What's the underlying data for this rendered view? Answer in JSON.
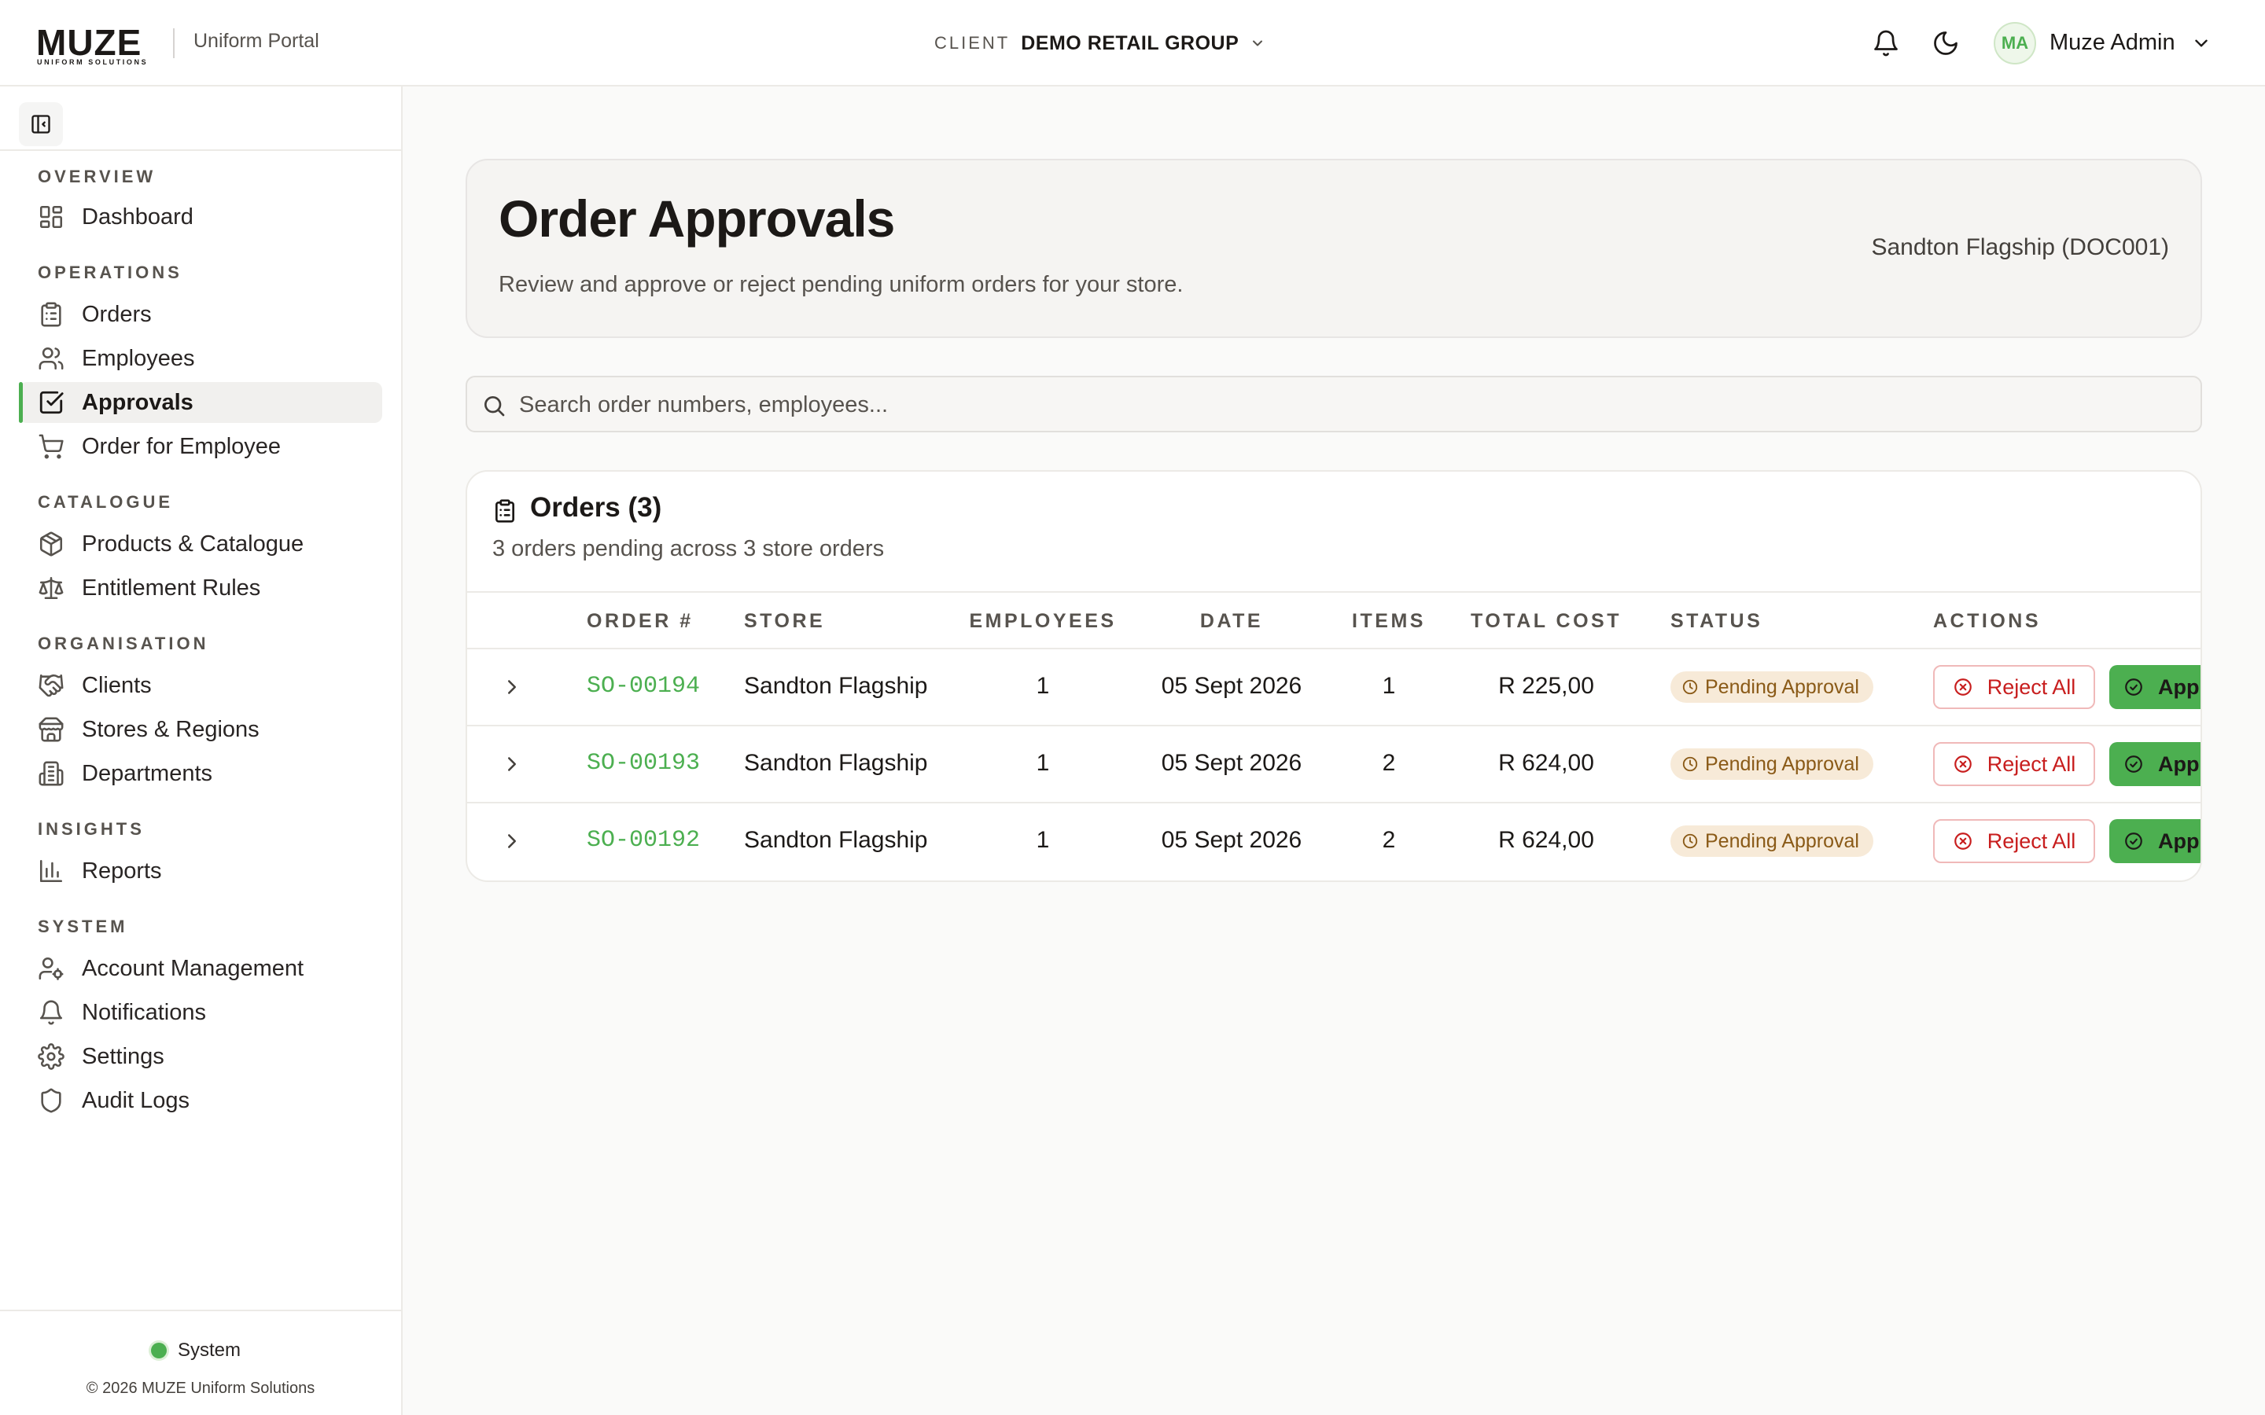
{
  "header": {
    "logo_text": "MUZE",
    "logo_subtext": "UNIFORM SOLUTIONS",
    "portal_name": "Uniform Portal",
    "client_label": "CLIENT",
    "client_name": "DEMO RETAIL GROUP",
    "user_initials": "MA",
    "user_name": "Muze Admin",
    "icons": [
      "bell-icon",
      "moon-icon",
      "chevron-down-icon"
    ]
  },
  "sidebar": {
    "sections": [
      {
        "label": "OVERVIEW",
        "items": [
          {
            "label": "Dashboard",
            "icon": "dashboard-icon"
          }
        ]
      },
      {
        "label": "OPERATIONS",
        "items": [
          {
            "label": "Orders",
            "icon": "clipboard-icon"
          },
          {
            "label": "Employees",
            "icon": "users-icon"
          },
          {
            "label": "Approvals",
            "icon": "check-square-icon",
            "active": true
          },
          {
            "label": "Order for Employee",
            "icon": "cart-icon"
          }
        ]
      },
      {
        "label": "CATALOGUE",
        "items": [
          {
            "label": "Products & Catalogue",
            "icon": "package-icon"
          },
          {
            "label": "Entitlement Rules",
            "icon": "scale-icon"
          }
        ]
      },
      {
        "label": "ORGANISATION",
        "items": [
          {
            "label": "Clients",
            "icon": "handshake-icon"
          },
          {
            "label": "Stores & Regions",
            "icon": "store-icon"
          },
          {
            "label": "Departments",
            "icon": "building-icon"
          }
        ]
      },
      {
        "label": "INSIGHTS",
        "items": [
          {
            "label": "Reports",
            "icon": "bar-chart-icon"
          }
        ]
      },
      {
        "label": "SYSTEM",
        "items": [
          {
            "label": "Account Management",
            "icon": "user-cog-icon"
          },
          {
            "label": "Notifications",
            "icon": "bell-icon"
          },
          {
            "label": "Settings",
            "icon": "gear-icon"
          },
          {
            "label": "Audit Logs",
            "icon": "shield-icon"
          }
        ]
      }
    ],
    "system_status": "System",
    "copyright": "© 2026 MUZE Uniform Solutions"
  },
  "page": {
    "title": "Order Approvals",
    "subtitle": "Review and approve or reject pending uniform orders for your store.",
    "store": "Sandton Flagship (DOC001)"
  },
  "search": {
    "placeholder": "Search order numbers, employees...",
    "value": ""
  },
  "orders": {
    "title": "Orders (3)",
    "subtitle": "3 orders pending across 3 store orders",
    "columns": [
      "ORDER #",
      "STORE",
      "EMPLOYEES",
      "DATE",
      "ITEMS",
      "TOTAL COST",
      "STATUS",
      "ACTIONS"
    ],
    "rows": [
      {
        "order": "SO-00194",
        "store": "Sandton Flagship",
        "employees": "1",
        "date": "05 Sept 2026",
        "items": "1",
        "total": "R 225,00",
        "status": "Pending Approval",
        "reject": "Reject All",
        "approve": "Approve All"
      },
      {
        "order": "SO-00193",
        "store": "Sandton Flagship",
        "employees": "1",
        "date": "05 Sept 2026",
        "items": "2",
        "total": "R 624,00",
        "status": "Pending Approval",
        "reject": "Reject All",
        "approve": "Approve All"
      },
      {
        "order": "SO-00192",
        "store": "Sandton Flagship",
        "employees": "1",
        "date": "05 Sept 2026",
        "items": "2",
        "total": "R 624,00",
        "status": "Pending Approval",
        "reject": "Reject All",
        "approve": "Approve All"
      }
    ]
  },
  "colors": {
    "accent": "#4caf50",
    "danger": "#c81e1e",
    "pending_bg": "#f7ead8",
    "pending_text": "#8a5a17"
  }
}
